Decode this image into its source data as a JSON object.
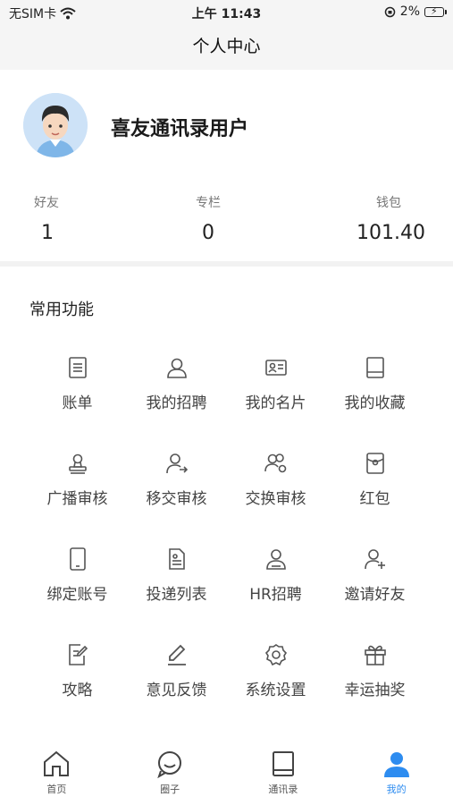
{
  "status_bar": {
    "carrier": "无SIM卡",
    "time": "上午 11:43",
    "battery": "2%"
  },
  "nav": {
    "title": "个人中心"
  },
  "profile": {
    "username": "喜友通讯录用户",
    "stats": [
      {
        "label": "好友",
        "value": "1"
      },
      {
        "label": "专栏",
        "value": "0"
      },
      {
        "label": "钱包",
        "value": "101.40"
      }
    ]
  },
  "functions": {
    "title": "常用功能",
    "items": [
      {
        "label": "账单",
        "icon": "bill-icon"
      },
      {
        "label": "我的招聘",
        "icon": "user-icon"
      },
      {
        "label": "我的名片",
        "icon": "id-card-icon"
      },
      {
        "label": "我的收藏",
        "icon": "book-icon"
      },
      {
        "label": "广播审核",
        "icon": "stamp-icon"
      },
      {
        "label": "移交审核",
        "icon": "user-transfer-icon"
      },
      {
        "label": "交换审核",
        "icon": "users-exchange-icon"
      },
      {
        "label": "红包",
        "icon": "red-packet-icon"
      },
      {
        "label": "绑定账号",
        "icon": "phone-icon"
      },
      {
        "label": "投递列表",
        "icon": "resume-icon"
      },
      {
        "label": "HR招聘",
        "icon": "hr-icon"
      },
      {
        "label": "邀请好友",
        "icon": "add-friend-icon"
      },
      {
        "label": "攻略",
        "icon": "edit-doc-icon"
      },
      {
        "label": "意见反馈",
        "icon": "pen-icon"
      },
      {
        "label": "系统设置",
        "icon": "gear-icon"
      },
      {
        "label": "幸运抽奖",
        "icon": "gift-icon"
      }
    ]
  },
  "tabbar": {
    "active_color": "#2d8cf0",
    "items": [
      {
        "label": "首页",
        "icon": "home-icon"
      },
      {
        "label": "圈子",
        "icon": "chat-icon"
      },
      {
        "label": "通讯录",
        "icon": "contacts-book-icon"
      },
      {
        "label": "我的",
        "icon": "person-icon"
      }
    ]
  }
}
